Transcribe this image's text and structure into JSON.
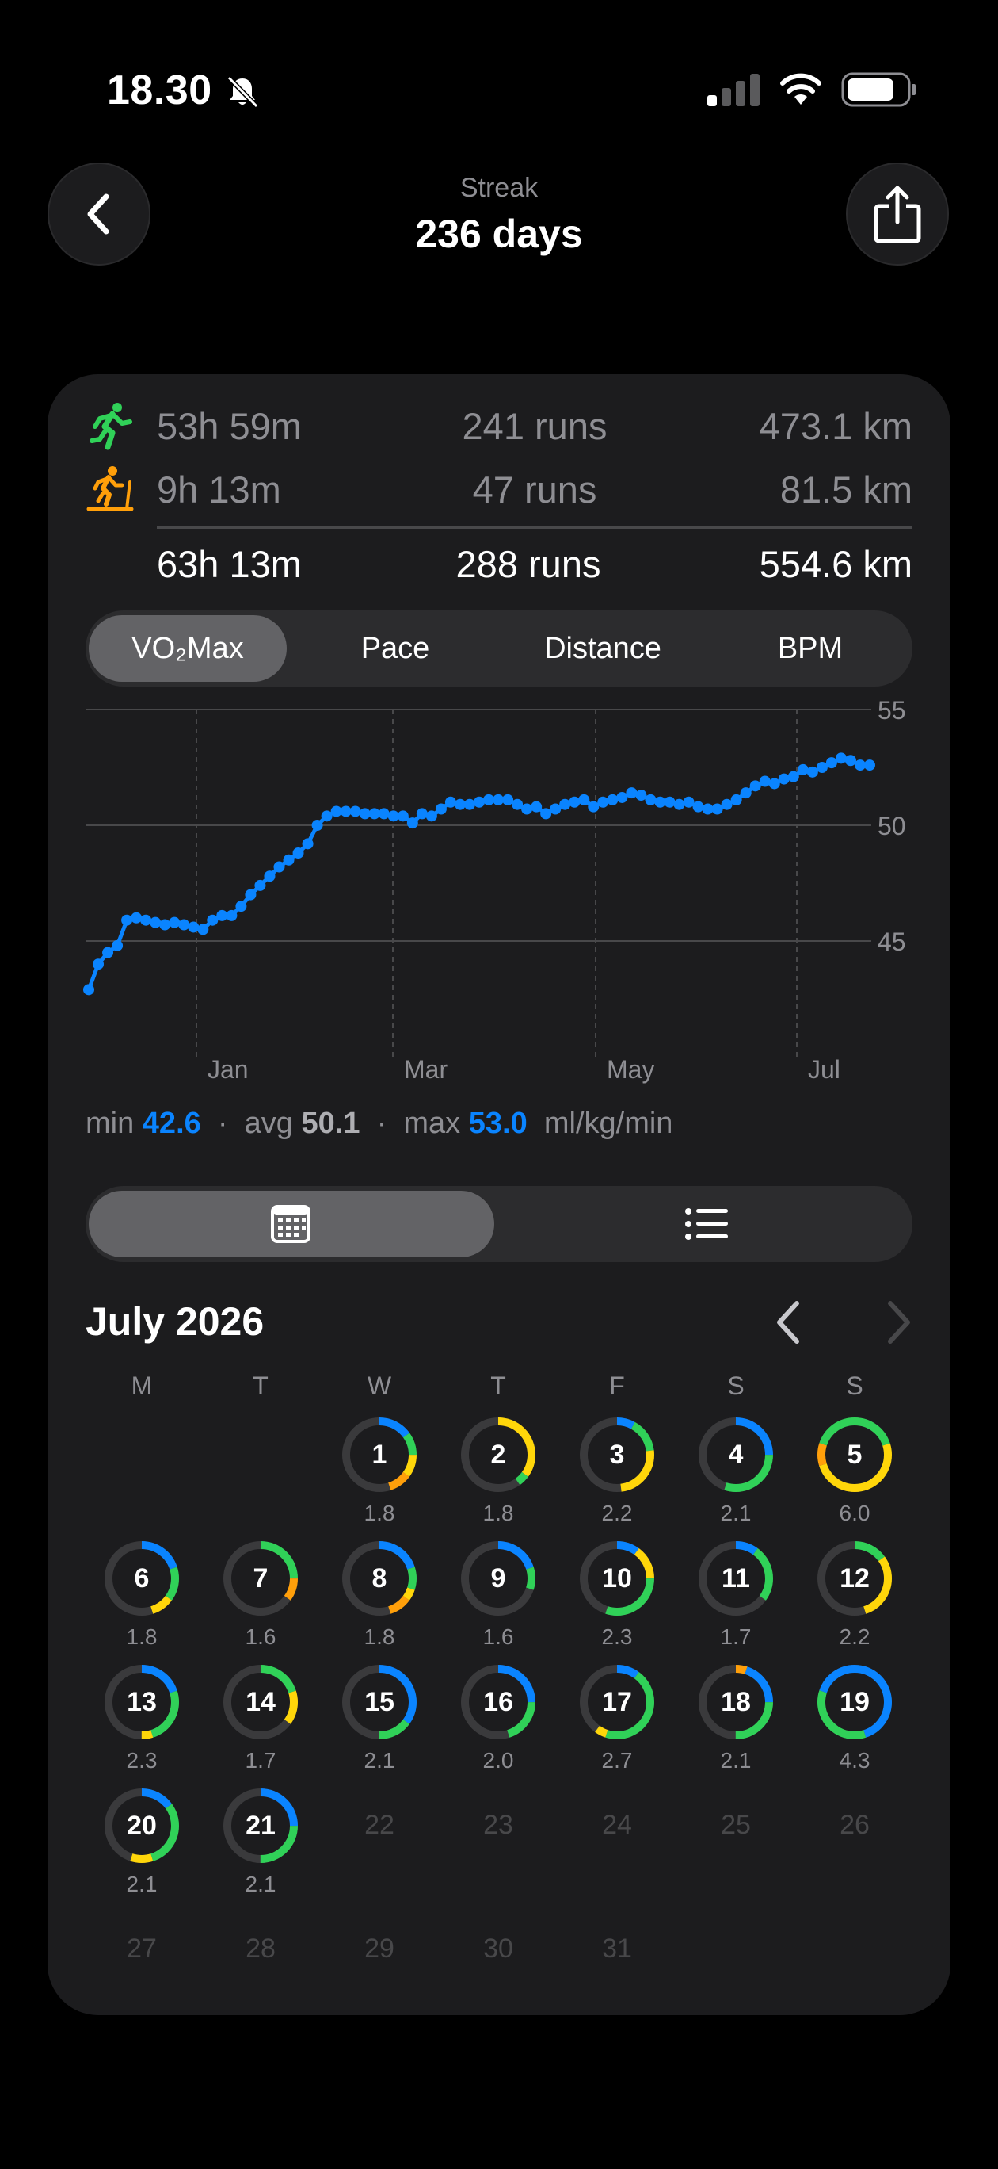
{
  "status_bar": {
    "time": "18.30"
  },
  "header": {
    "subtitle": "Streak",
    "title": "236 days"
  },
  "stats": {
    "outdoor": {
      "time": "53h 59m",
      "runs": "241 runs",
      "distance": "473.1 km"
    },
    "treadmill": {
      "time": "9h 13m",
      "runs": "47 runs",
      "distance": "81.5 km"
    },
    "total": {
      "time": "63h 13m",
      "runs": "288 runs",
      "distance": "554.6 km"
    }
  },
  "metric_tabs": [
    "VO₂Max",
    "Pace",
    "Distance",
    "BPM"
  ],
  "selected_tab": "VO₂Max",
  "chart_data": {
    "type": "line",
    "x_tick_labels": [
      "Jan",
      "Mar",
      "May",
      "Jul"
    ],
    "y_tick_labels": [
      "55",
      "50",
      "45"
    ],
    "ylim": [
      40,
      55
    ],
    "grid": true,
    "color": "#0a84ff",
    "series": [
      {
        "values": [
          42.9,
          44.0,
          44.5,
          44.8,
          45.9,
          46.0,
          45.9,
          45.8,
          45.7,
          45.8,
          45.7,
          45.6,
          45.5,
          45.9,
          46.1,
          46.1,
          46.5,
          47.0,
          47.4,
          47.8,
          48.2,
          48.5,
          48.8,
          49.2,
          50.0,
          50.4,
          50.6,
          50.6,
          50.6,
          50.5,
          50.5,
          50.5,
          50.4,
          50.4,
          50.1,
          50.5,
          50.4,
          50.7,
          51.0,
          50.9,
          50.9,
          51.0,
          51.1,
          51.1,
          51.1,
          50.9,
          50.7,
          50.8,
          50.5,
          50.7,
          50.9,
          51.0,
          51.1,
          50.8,
          51.0,
          51.1,
          51.2,
          51.4,
          51.3,
          51.1,
          51.0,
          51.0,
          50.9,
          51.0,
          50.8,
          50.7,
          50.7,
          50.9,
          51.1,
          51.4,
          51.7,
          51.9,
          51.8,
          52.0,
          52.1,
          52.4,
          52.3,
          52.5,
          52.7,
          52.9,
          52.8,
          52.6,
          52.6
        ]
      }
    ]
  },
  "chart_summary": {
    "min_label": "min",
    "min_value": "42.6",
    "avg_label": "avg",
    "avg_value": "50.1",
    "max_label": "max",
    "max_value": "53.0",
    "sep": "·",
    "unit": "ml/kg/min"
  },
  "calendar": {
    "month_title": "July 2026",
    "weekdays": [
      "M",
      "T",
      "W",
      "T",
      "F",
      "S",
      "S"
    ],
    "days": [
      {
        "day": "1",
        "dist": "1.8",
        "segments": [
          {
            "c": "#0a84ff",
            "f": 0.15
          },
          {
            "c": "#30d158",
            "f": 0.1
          },
          {
            "c": "#ffd60a",
            "f": 0.1
          },
          {
            "c": "#ff9f0a",
            "f": 0.1
          }
        ]
      },
      {
        "day": "2",
        "dist": "1.8",
        "segments": [
          {
            "c": "#ffd60a",
            "f": 0.35
          },
          {
            "c": "#30d158",
            "f": 0.05
          }
        ]
      },
      {
        "day": "3",
        "dist": "2.2",
        "segments": [
          {
            "c": "#0a84ff",
            "f": 0.08
          },
          {
            "c": "#30d158",
            "f": 0.15
          },
          {
            "c": "#ffd60a",
            "f": 0.25
          }
        ]
      },
      {
        "day": "4",
        "dist": "2.1",
        "segments": [
          {
            "c": "#0a84ff",
            "f": 0.25
          },
          {
            "c": "#30d158",
            "f": 0.3
          }
        ]
      },
      {
        "day": "5",
        "dist": "6.0",
        "segments": [
          {
            "c": "#30d158",
            "f": 0.2
          },
          {
            "c": "#ffd60a",
            "f": 0.5
          },
          {
            "c": "#ff9f0a",
            "f": 0.1
          },
          {
            "c": "#30d158",
            "f": 0.2
          }
        ]
      },
      {
        "day": "6",
        "dist": "1.8",
        "segments": [
          {
            "c": "#0a84ff",
            "f": 0.2
          },
          {
            "c": "#30d158",
            "f": 0.15
          },
          {
            "c": "#ffd60a",
            "f": 0.1
          }
        ]
      },
      {
        "day": "7",
        "dist": "1.6",
        "segments": [
          {
            "c": "#30d158",
            "f": 0.25
          },
          {
            "c": "#ff9f0a",
            "f": 0.1
          }
        ]
      },
      {
        "day": "8",
        "dist": "1.8",
        "segments": [
          {
            "c": "#0a84ff",
            "f": 0.2
          },
          {
            "c": "#30d158",
            "f": 0.1
          },
          {
            "c": "#ffd60a",
            "f": 0.05
          },
          {
            "c": "#ff9f0a",
            "f": 0.1
          }
        ]
      },
      {
        "day": "9",
        "dist": "1.6",
        "segments": [
          {
            "c": "#0a84ff",
            "f": 0.2
          },
          {
            "c": "#30d158",
            "f": 0.1
          }
        ]
      },
      {
        "day": "10",
        "dist": "2.3",
        "segments": [
          {
            "c": "#0a84ff",
            "f": 0.1
          },
          {
            "c": "#ffd60a",
            "f": 0.15
          },
          {
            "c": "#30d158",
            "f": 0.3
          }
        ]
      },
      {
        "day": "11",
        "dist": "1.7",
        "segments": [
          {
            "c": "#0a84ff",
            "f": 0.1
          },
          {
            "c": "#30d158",
            "f": 0.25
          }
        ]
      },
      {
        "day": "12",
        "dist": "2.2",
        "segments": [
          {
            "c": "#30d158",
            "f": 0.15
          },
          {
            "c": "#ffd60a",
            "f": 0.3
          }
        ]
      },
      {
        "day": "13",
        "dist": "2.3",
        "segments": [
          {
            "c": "#0a84ff",
            "f": 0.2
          },
          {
            "c": "#30d158",
            "f": 0.25
          },
          {
            "c": "#ffd60a",
            "f": 0.05
          }
        ]
      },
      {
        "day": "14",
        "dist": "1.7",
        "segments": [
          {
            "c": "#30d158",
            "f": 0.2
          },
          {
            "c": "#ffd60a",
            "f": 0.15
          }
        ]
      },
      {
        "day": "15",
        "dist": "2.1",
        "segments": [
          {
            "c": "#0a84ff",
            "f": 0.35
          },
          {
            "c": "#30d158",
            "f": 0.15
          }
        ]
      },
      {
        "day": "16",
        "dist": "2.0",
        "segments": [
          {
            "c": "#0a84ff",
            "f": 0.25
          },
          {
            "c": "#30d158",
            "f": 0.2
          }
        ]
      },
      {
        "day": "17",
        "dist": "2.7",
        "segments": [
          {
            "c": "#0a84ff",
            "f": 0.1
          },
          {
            "c": "#30d158",
            "f": 0.45
          },
          {
            "c": "#ffd60a",
            "f": 0.05
          }
        ]
      },
      {
        "day": "18",
        "dist": "2.1",
        "segments": [
          {
            "c": "#ff9f0a",
            "f": 0.05
          },
          {
            "c": "#0a84ff",
            "f": 0.2
          },
          {
            "c": "#30d158",
            "f": 0.25
          }
        ]
      },
      {
        "day": "19",
        "dist": "4.3",
        "segments": [
          {
            "c": "#0a84ff",
            "f": 0.45
          },
          {
            "c": "#30d158",
            "f": 0.35
          },
          {
            "c": "#0a84ff",
            "f": 0.2
          }
        ]
      },
      {
        "day": "20",
        "dist": "2.1",
        "segments": [
          {
            "c": "#0a84ff",
            "f": 0.15
          },
          {
            "c": "#30d158",
            "f": 0.3
          },
          {
            "c": "#ffd60a",
            "f": 0.1
          }
        ]
      },
      {
        "day": "21",
        "dist": "2.1",
        "segments": [
          {
            "c": "#0a84ff",
            "f": 0.25
          },
          {
            "c": "#30d158",
            "f": 0.25
          }
        ]
      }
    ],
    "future_days": [
      "22",
      "23",
      "24",
      "25",
      "26",
      "27",
      "28",
      "29",
      "30",
      "31"
    ]
  }
}
